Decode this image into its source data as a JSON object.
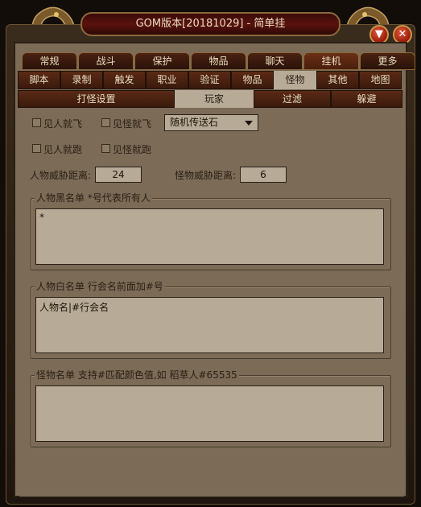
{
  "title": "GOM版本[20181029] - 简单挂",
  "controls": {
    "minimize_icon": "▼",
    "close_icon": "✕"
  },
  "tabs_top": [
    "常规",
    "战斗",
    "保护",
    "物品",
    "聊天",
    "挂机",
    "更多"
  ],
  "tabs_second": [
    "脚本",
    "录制",
    "触发",
    "职业",
    "验证",
    "物品",
    "怪物",
    "其他",
    "地图"
  ],
  "tabs_third": [
    "打怪设置",
    "玩家",
    "过滤",
    "躲避"
  ],
  "options": {
    "see_player_fly": "见人就飞",
    "see_monster_fly": "见怪就飞",
    "see_player_run": "见人就跑",
    "see_monster_run": "见怪就跑",
    "fly_item": "随机传送石"
  },
  "distances": {
    "player_label": "人物威胁距离:",
    "player_value": "24",
    "monster_label": "怪物威胁距离:",
    "monster_value": "6"
  },
  "blacklist": {
    "title": "人物黑名单  *号代表所有人",
    "value": "*"
  },
  "whitelist": {
    "title": "人物白名单  行会名前面加#号",
    "value": "人物名|#行会名"
  },
  "monsters": {
    "title": "怪物名单  支持#匹配颜色值,如 稻草人#65535",
    "value": ""
  }
}
